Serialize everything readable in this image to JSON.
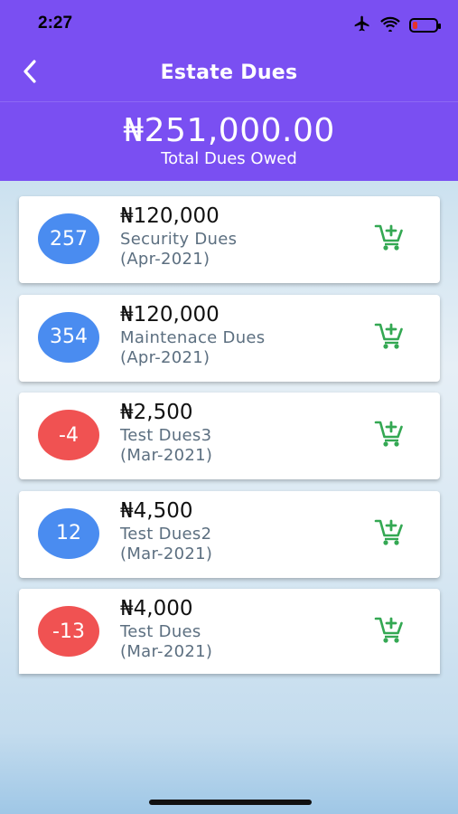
{
  "status_bar": {
    "time": "2:27",
    "icons": [
      "airplane-icon",
      "wifi-icon",
      "battery-icon"
    ],
    "battery_level": 0.2,
    "battery_color": "#e6322b"
  },
  "header": {
    "title": "Estate Dues",
    "back_icon": "chevron-left-icon",
    "background": "#7a4ff2"
  },
  "summary": {
    "total_amount": "₦251,000.00",
    "total_label": "Total Dues Owed"
  },
  "dues": [
    {
      "badge": "257",
      "badge_color": "#4a8cf0",
      "amount": "₦120,000",
      "name": "Security Dues",
      "period": "(Apr-2021)",
      "action_icon": "add-to-cart-icon"
    },
    {
      "badge": "354",
      "badge_color": "#4a8cf0",
      "amount": "₦120,000",
      "name": "Maintenace Dues",
      "period": "(Apr-2021)",
      "action_icon": "add-to-cart-icon"
    },
    {
      "badge": "-4",
      "badge_color": "#f05252",
      "amount": "₦2,500",
      "name": "Test Dues3",
      "period": "(Mar-2021)",
      "action_icon": "add-to-cart-icon"
    },
    {
      "badge": "12",
      "badge_color": "#4a8cf0",
      "amount": "₦4,500",
      "name": "Test Dues2",
      "period": "(Mar-2021)",
      "action_icon": "add-to-cart-icon"
    },
    {
      "badge": "-13",
      "badge_color": "#f05252",
      "amount": "₦4,000",
      "name": "Test Dues",
      "period": "(Mar-2021)",
      "action_icon": "add-to-cart-icon"
    }
  ],
  "colors": {
    "accent_green": "#34a853",
    "badge_blue": "#4a8cf0",
    "badge_red": "#f05252"
  }
}
